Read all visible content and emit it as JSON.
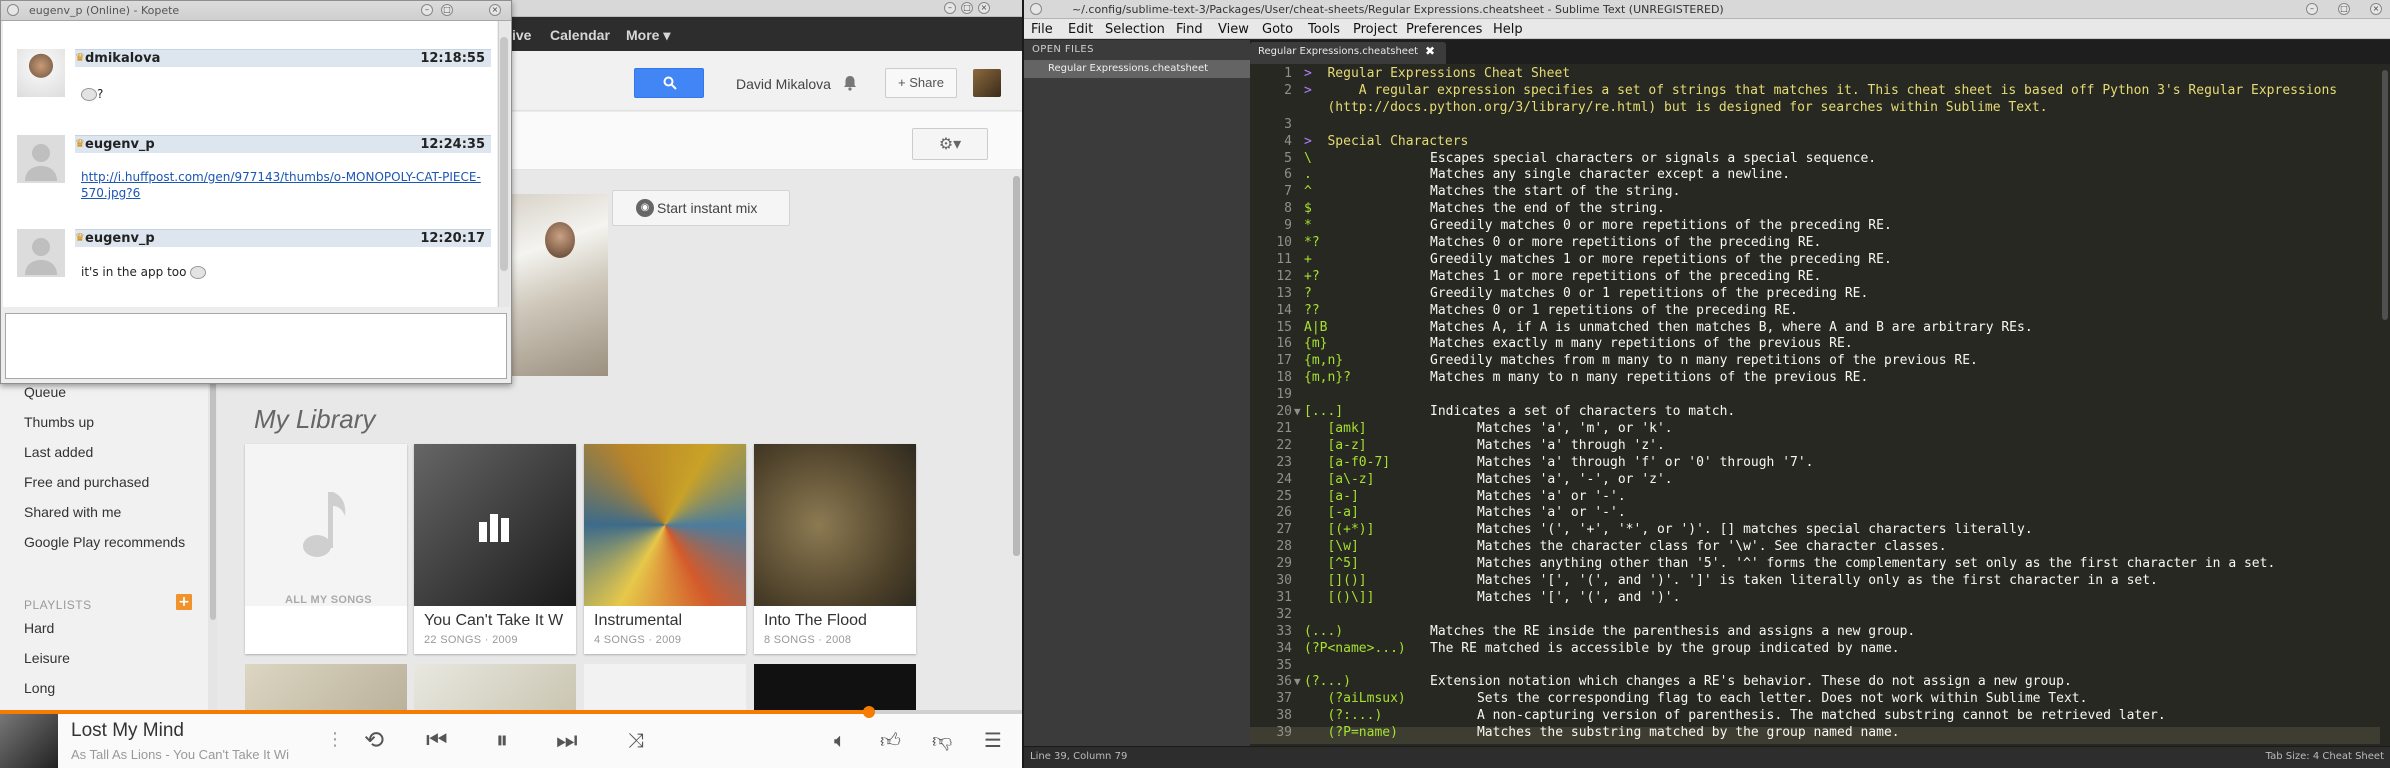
{
  "browser": {
    "gbar": [
      "ive",
      "Calendar",
      "More ▾"
    ],
    "user_name": "David Mikalova",
    "share_label": "Share",
    "instant_mix_label": "Start instant mix",
    "library_title": "My Library",
    "sidebar_items": [
      "Queue",
      "Thumbs up",
      "Last added",
      "Free and purchased",
      "Shared with me",
      "Google Play recommends"
    ],
    "playlists_heading": "PLAYLISTS",
    "playlists": [
      "Hard",
      "Leisure",
      "Long"
    ],
    "cards": [
      {
        "title": "",
        "subtitle": "ALL MY SONGS"
      },
      {
        "title": "You Can't Take It W",
        "subtitle": "22 SONGS · 2009"
      },
      {
        "title": "Instrumental",
        "subtitle": "4 SONGS · 2009"
      },
      {
        "title": "Into The Flood",
        "subtitle": "8 SONGS · 2008"
      }
    ],
    "now_playing": {
      "title": "Lost My Mind",
      "subtitle": "As Tall As Lions - You Can't Take It Wi",
      "progress": 0.85
    }
  },
  "kopete": {
    "title": "eugenv_p (Online) - Kopete",
    "messages": [
      {
        "name": "dmikalova",
        "time": "12:18:55",
        "text": "?"
      },
      {
        "name": "eugenv_p",
        "time": "12:24:35",
        "text": "http://i.huffpost.com/gen/977143/thumbs/o-MONOPOLY-CAT-PIECE-570.jpg?6"
      },
      {
        "name": "eugenv_p",
        "time": "12:20:17",
        "text": "it's in the app too"
      }
    ]
  },
  "sublime": {
    "title": "~/.config/sublime-text-3/Packages/User/cheat-sheets/Regular Expressions.cheatsheet - Sublime Text (UNREGISTERED)",
    "menu": [
      "File",
      "Edit",
      "Selection",
      "Find",
      "View",
      "Goto",
      "Tools",
      "Project",
      "Preferences",
      "Help"
    ],
    "side_heading": "OPEN FILES",
    "open_file": "Regular Expressions.cheatsheet",
    "tab_label": "Regular Expressions.cheatsheet",
    "status_left": "Line 39, Column 79",
    "status_right": "Tab Size: 4    Cheat Sheet",
    "lines": [
      {
        "n": "1",
        "k": ">  Regular Expressions Cheat Sheet",
        "d": "",
        "t": "head"
      },
      {
        "n": "2",
        "k": ">      A regular expression specifies a set of strings that matches it. This cheat sheet is based off Python 3's Regular Expressions",
        "d": "",
        "t": "head"
      },
      {
        "n": "",
        "k": "   (http://docs.python.org/3/library/re.html) but is designed for searches within Sublime Text.",
        "d": "",
        "t": "head"
      },
      {
        "n": "3",
        "k": "",
        "d": "",
        "t": "head"
      },
      {
        "n": "4",
        "k": ">  Special Characters",
        "d": "",
        "t": "head"
      },
      {
        "n": "5",
        "k": "\\",
        "d": "Escapes special characters or signals a special sequence.",
        "t": "kv"
      },
      {
        "n": "6",
        "k": ".",
        "d": "Matches any single character except a newline.",
        "t": "kv"
      },
      {
        "n": "7",
        "k": "^",
        "d": "Matches the start of the string.",
        "t": "kv"
      },
      {
        "n": "8",
        "k": "$",
        "d": "Matches the end of the string.",
        "t": "kv"
      },
      {
        "n": "9",
        "k": "*",
        "d": "Greedily matches 0 or more repetitions of the preceding RE.",
        "t": "kv"
      },
      {
        "n": "10",
        "k": "*?",
        "d": "Matches 0 or more repetitions of the preceding RE.",
        "t": "kv"
      },
      {
        "n": "11",
        "k": "+",
        "d": "Greedily matches 1 or more repetitions of the preceding RE.",
        "t": "kv"
      },
      {
        "n": "12",
        "k": "+?",
        "d": "Matches 1 or more repetitions of the preceding RE.",
        "t": "kv"
      },
      {
        "n": "13",
        "k": "?",
        "d": "Greedily matches 0 or 1 repetitions of the preceding RE.",
        "t": "kv"
      },
      {
        "n": "14",
        "k": "??",
        "d": "Matches 0 or 1 repetitions of the preceding RE.",
        "t": "kv"
      },
      {
        "n": "15",
        "k": "A|B",
        "d": "Matches A, if A is unmatched then matches B, where A and B are arbitrary REs.",
        "t": "kv"
      },
      {
        "n": "16",
        "k": "{m}",
        "d": "Matches exactly m many repetitions of the previous RE.",
        "t": "kv"
      },
      {
        "n": "17",
        "k": "{m,n}",
        "d": "Greedily matches from m many to n many repetitions of the previous RE.",
        "t": "kv"
      },
      {
        "n": "18",
        "k": "{m,n}?",
        "d": "Matches m many to n many repetitions of the previous RE.",
        "t": "kv"
      },
      {
        "n": "19",
        "k": "",
        "d": "",
        "t": "kv"
      },
      {
        "n": "20",
        "k": "[...]",
        "d": "Indicates a set of characters to match.",
        "t": "kv",
        "fold": true
      },
      {
        "n": "21",
        "k": "   [amk]",
        "d": "      Matches 'a', 'm', or 'k'.",
        "t": "kv"
      },
      {
        "n": "22",
        "k": "   [a-z]",
        "d": "      Matches 'a' through 'z'.",
        "t": "kv"
      },
      {
        "n": "23",
        "k": "   [a-f0-7]",
        "d": "      Matches 'a' through 'f' or '0' through '7'.",
        "t": "kv"
      },
      {
        "n": "24",
        "k": "   [a\\-z]",
        "d": "      Matches 'a', '-', or 'z'.",
        "t": "kv"
      },
      {
        "n": "25",
        "k": "   [a-]",
        "d": "      Matches 'a' or '-'.",
        "t": "kv"
      },
      {
        "n": "26",
        "k": "   [-a]",
        "d": "      Matches 'a' or '-'.",
        "t": "kv"
      },
      {
        "n": "27",
        "k": "   [(+*)]",
        "d": "      Matches '(', '+', '*', or ')'. [] matches special characters literally.",
        "t": "kv"
      },
      {
        "n": "28",
        "k": "   [\\w]",
        "d": "      Matches the character class for '\\w'. See character classes.",
        "t": "kv"
      },
      {
        "n": "29",
        "k": "   [^5]",
        "d": "      Matches anything other than '5'. '^' forms the complementary set only as the first character in a set.",
        "t": "kv"
      },
      {
        "n": "30",
        "k": "   []()]",
        "d": "      Matches '[', '(', and ')'. ']' is taken literally only as the first character in a set.",
        "t": "kv"
      },
      {
        "n": "31",
        "k": "   [()\\]]",
        "d": "      Matches '[', '(', and ')'.",
        "t": "kv"
      },
      {
        "n": "32",
        "k": "",
        "d": "",
        "t": "kv"
      },
      {
        "n": "33",
        "k": "(...)",
        "d": "Matches the RE inside the parenthesis and assigns a new group.",
        "t": "kv"
      },
      {
        "n": "34",
        "k": "(?P<name>...)",
        "d": "The RE matched is accessible by the group indicated by name.",
        "t": "kv"
      },
      {
        "n": "35",
        "k": "",
        "d": "",
        "t": "kv"
      },
      {
        "n": "36",
        "k": "(?...)",
        "d": "Extension notation which changes a RE's behavior. These do not assign a new group.",
        "t": "kv",
        "fold": true
      },
      {
        "n": "37",
        "k": "   (?aiLmsux)",
        "d": "      Sets the corresponding flag to each letter. Does not work within Sublime Text.",
        "t": "kv"
      },
      {
        "n": "38",
        "k": "   (?:...)",
        "d": "      A non-capturing version of parenthesis. The matched substring cannot be retrieved later.",
        "t": "kv"
      },
      {
        "n": "39",
        "k": "   (?P=name)",
        "d": "      Matches the substring matched by the group named name.",
        "t": "kv"
      }
    ]
  }
}
